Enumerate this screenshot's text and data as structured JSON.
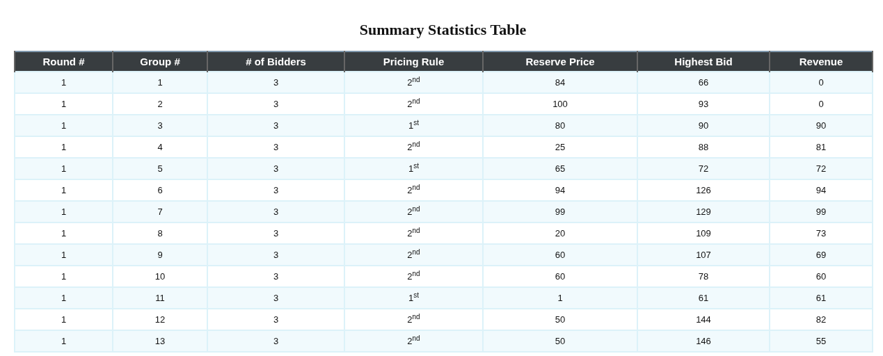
{
  "title": "Summary Statistics Table",
  "table": {
    "columns": [
      "Round #",
      "Group #",
      "# of Bidders",
      "Pricing Rule",
      "Reserve Price",
      "Highest Bid",
      "Revenue"
    ],
    "rows": [
      [
        "1",
        "1",
        "3",
        "2$^{nd}$",
        "84",
        "66",
        "0"
      ],
      [
        "1",
        "2",
        "3",
        "2$^{nd}$",
        "100",
        "93",
        "0"
      ],
      [
        "1",
        "3",
        "3",
        "1$^{st}$",
        "80",
        "90",
        "90"
      ],
      [
        "1",
        "4",
        "3",
        "2$^{nd}$",
        "25",
        "88",
        "81"
      ],
      [
        "1",
        "5",
        "3",
        "1$^{st}$",
        "65",
        "72",
        "72"
      ],
      [
        "1",
        "6",
        "3",
        "2$^{nd}$",
        "94",
        "126",
        "94"
      ],
      [
        "1",
        "7",
        "3",
        "2$^{nd}$",
        "99",
        "129",
        "99"
      ],
      [
        "1",
        "8",
        "3",
        "2$^{nd}$",
        "20",
        "109",
        "73"
      ],
      [
        "1",
        "9",
        "3",
        "2$^{nd}$",
        "60",
        "107",
        "69"
      ],
      [
        "1",
        "10",
        "3",
        "2$^{nd}$",
        "60",
        "78",
        "60"
      ],
      [
        "1",
        "11",
        "3",
        "1$^{st}$",
        "1",
        "61",
        "61"
      ],
      [
        "1",
        "12",
        "3",
        "2$^{nd}$",
        "50",
        "144",
        "82"
      ],
      [
        "1",
        "13",
        "3",
        "2$^{nd}$",
        "50",
        "146",
        "55"
      ]
    ]
  }
}
